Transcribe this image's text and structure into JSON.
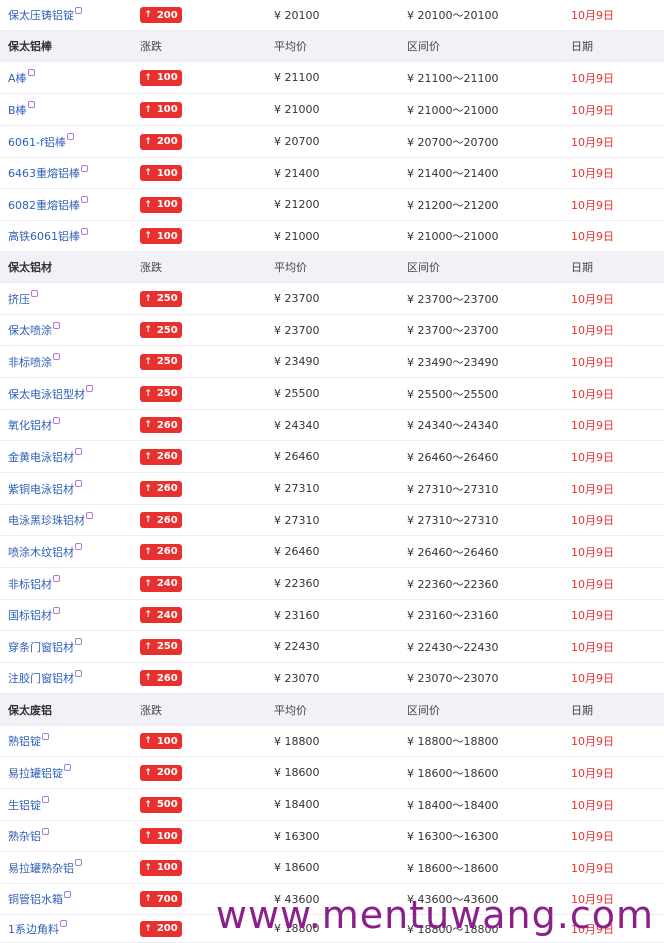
{
  "currency": "¥",
  "section_headers": [
    {
      "title": "保太铝棒",
      "change": "涨跌",
      "avg": "平均价",
      "range": "区间价",
      "date": "日期"
    },
    {
      "title": "保太铝材",
      "change": "涨跌",
      "avg": "平均价",
      "range": "区间价",
      "date": "日期"
    },
    {
      "title": "保太废铝",
      "change": "涨跌",
      "avg": "平均价",
      "range": "区间价",
      "date": "日期"
    }
  ],
  "rows": [
    {
      "name": "保太压铸铝锭",
      "change": "200",
      "avg": "¥  20100",
      "range": "¥  20100～20100",
      "date": "10月9日"
    },
    {
      "name": "A棒",
      "change": "100",
      "avg": "¥  21100",
      "range": "¥  21100～21100",
      "date": "10月9日"
    },
    {
      "name": "B棒",
      "change": "100",
      "avg": "¥  21000",
      "range": "¥  21000～21000",
      "date": "10月9日"
    },
    {
      "name": "6061-f铝棒",
      "change": "200",
      "avg": "¥  20700",
      "range": "¥  20700～20700",
      "date": "10月9日"
    },
    {
      "name": "6463重熔铝棒",
      "change": "100",
      "avg": "¥  21400",
      "range": "¥  21400～21400",
      "date": "10月9日"
    },
    {
      "name": "6082重熔铝棒",
      "change": "100",
      "avg": "¥  21200",
      "range": "¥  21200～21200",
      "date": "10月9日"
    },
    {
      "name": "高铁6061铝棒",
      "change": "100",
      "avg": "¥  21000",
      "range": "¥  21000～21000",
      "date": "10月9日"
    },
    {
      "name": "挤压",
      "change": "250",
      "avg": "¥  23700",
      "range": "¥  23700～23700",
      "date": "10月9日"
    },
    {
      "name": "保太喷涂",
      "change": "250",
      "avg": "¥  23700",
      "range": "¥  23700～23700",
      "date": "10月9日"
    },
    {
      "name": "非标喷涂",
      "change": "250",
      "avg": "¥  23490",
      "range": "¥  23490～23490",
      "date": "10月9日"
    },
    {
      "name": "保太电泳铝型材",
      "change": "250",
      "avg": "¥  25500",
      "range": "¥  25500～25500",
      "date": "10月9日"
    },
    {
      "name": "氧化铝材",
      "change": "260",
      "avg": "¥  24340",
      "range": "¥  24340～24340",
      "date": "10月9日"
    },
    {
      "name": "金黄电泳铝材",
      "change": "260",
      "avg": "¥  26460",
      "range": "¥  26460～26460",
      "date": "10月9日"
    },
    {
      "name": "紫铜电泳铝材",
      "change": "260",
      "avg": "¥  27310",
      "range": "¥  27310～27310",
      "date": "10月9日"
    },
    {
      "name": "电泳黑珍珠铝材",
      "change": "260",
      "avg": "¥  27310",
      "range": "¥  27310～27310",
      "date": "10月9日"
    },
    {
      "name": "喷涂木纹铝材",
      "change": "260",
      "avg": "¥  26460",
      "range": "¥  26460～26460",
      "date": "10月9日"
    },
    {
      "name": "非标铝材",
      "change": "240",
      "avg": "¥  22360",
      "range": "¥  22360～22360",
      "date": "10月9日"
    },
    {
      "name": "国标铝材",
      "change": "240",
      "avg": "¥  23160",
      "range": "¥  23160～23160",
      "date": "10月9日"
    },
    {
      "name": "穿条门窗铝材",
      "change": "250",
      "avg": "¥  22430",
      "range": "¥  22430～22430",
      "date": "10月9日"
    },
    {
      "name": "注胶门窗铝材",
      "change": "260",
      "avg": "¥  23070",
      "range": "¥  23070～23070",
      "date": "10月9日"
    },
    {
      "name": "熟铝锭",
      "change": "100",
      "avg": "¥  18800",
      "range": "¥  18800～18800",
      "date": "10月9日"
    },
    {
      "name": "易拉罐铝锭",
      "change": "200",
      "avg": "¥  18600",
      "range": "¥  18600～18600",
      "date": "10月9日"
    },
    {
      "name": "生铝锭",
      "change": "500",
      "avg": "¥  18400",
      "range": "¥  18400～18400",
      "date": "10月9日"
    },
    {
      "name": "熟杂铝",
      "change": "100",
      "avg": "¥  16300",
      "range": "¥  16300～16300",
      "date": "10月9日"
    },
    {
      "name": "易拉罐熟杂铝",
      "change": "100",
      "avg": "¥  18600",
      "range": "¥  18600～18600",
      "date": "10月9日"
    },
    {
      "name": "铜管铝水箱",
      "change": "700",
      "avg": "¥  43600",
      "range": "¥  43600～43600",
      "date": "10月9日"
    },
    {
      "name": "1系边角料",
      "change": "200",
      "avg": "¥  18800",
      "range": "¥  18800～18800",
      "date": "10月9日"
    }
  ],
  "watermark": "www.mentuwang.com",
  "colors": {
    "badge": "#e8312f",
    "link": "#2f5fb8",
    "date": "#e8312f",
    "header_bg": "#f1f1f7"
  }
}
